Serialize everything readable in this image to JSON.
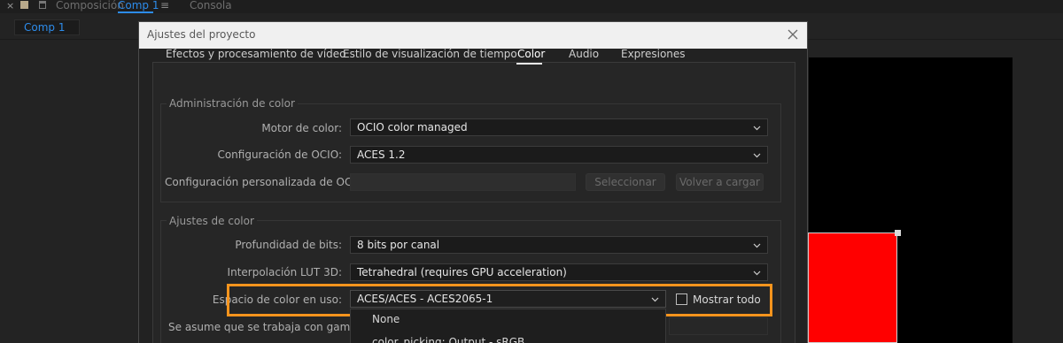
{
  "app": {
    "close_glyph": "×",
    "tab_composition": "Composición",
    "tab_comp1": "Comp 1",
    "menu_glyph": "≡",
    "tab_console": "Consola",
    "comp_chip": "Comp 1"
  },
  "dialog": {
    "title": "Ajustes del proyecto",
    "tabs": [
      {
        "label": "Efectos y procesamiento de vídeo",
        "active": false
      },
      {
        "label": "Estilo de visualización de tiempo",
        "active": false
      },
      {
        "label": "Color",
        "active": true
      },
      {
        "label": "Audio",
        "active": false
      },
      {
        "label": "Expresiones",
        "active": false
      }
    ],
    "color_management": {
      "title": "Administración de color",
      "engine_label": "Motor de color:",
      "engine_value": "OCIO color managed",
      "ocio_config_label": "Configuración de OCIO:",
      "ocio_config_value": "ACES 1.2",
      "custom_ocio_label": "Configuración personalizada de OCIO:",
      "custom_ocio_value": "",
      "select_button": "Seleccionar",
      "reload_button": "Volver a cargar"
    },
    "color_settings": {
      "title": "Ajustes de color",
      "bit_depth_label": "Profundidad de bits:",
      "bit_depth_value": "8 bits por canal",
      "lut_label": "Interpolación LUT 3D:",
      "lut_value": "Tetrahedral (requires GPU acceleration)",
      "working_space_label": "Espacio de color en uso:",
      "working_space_value": "ACES/ACES - ACES2065-1",
      "show_all_label": "Mostrar todo",
      "show_all_checked": false,
      "gamma_label": "Se asume que se trabaja con gama:"
    },
    "dropdown_items": [
      "None",
      "color_picking: Output - sRGB"
    ]
  },
  "colors": {
    "accent_blue": "#2d8ceb",
    "highlight_orange": "#f7941d",
    "layer_red": "#ff0000"
  }
}
